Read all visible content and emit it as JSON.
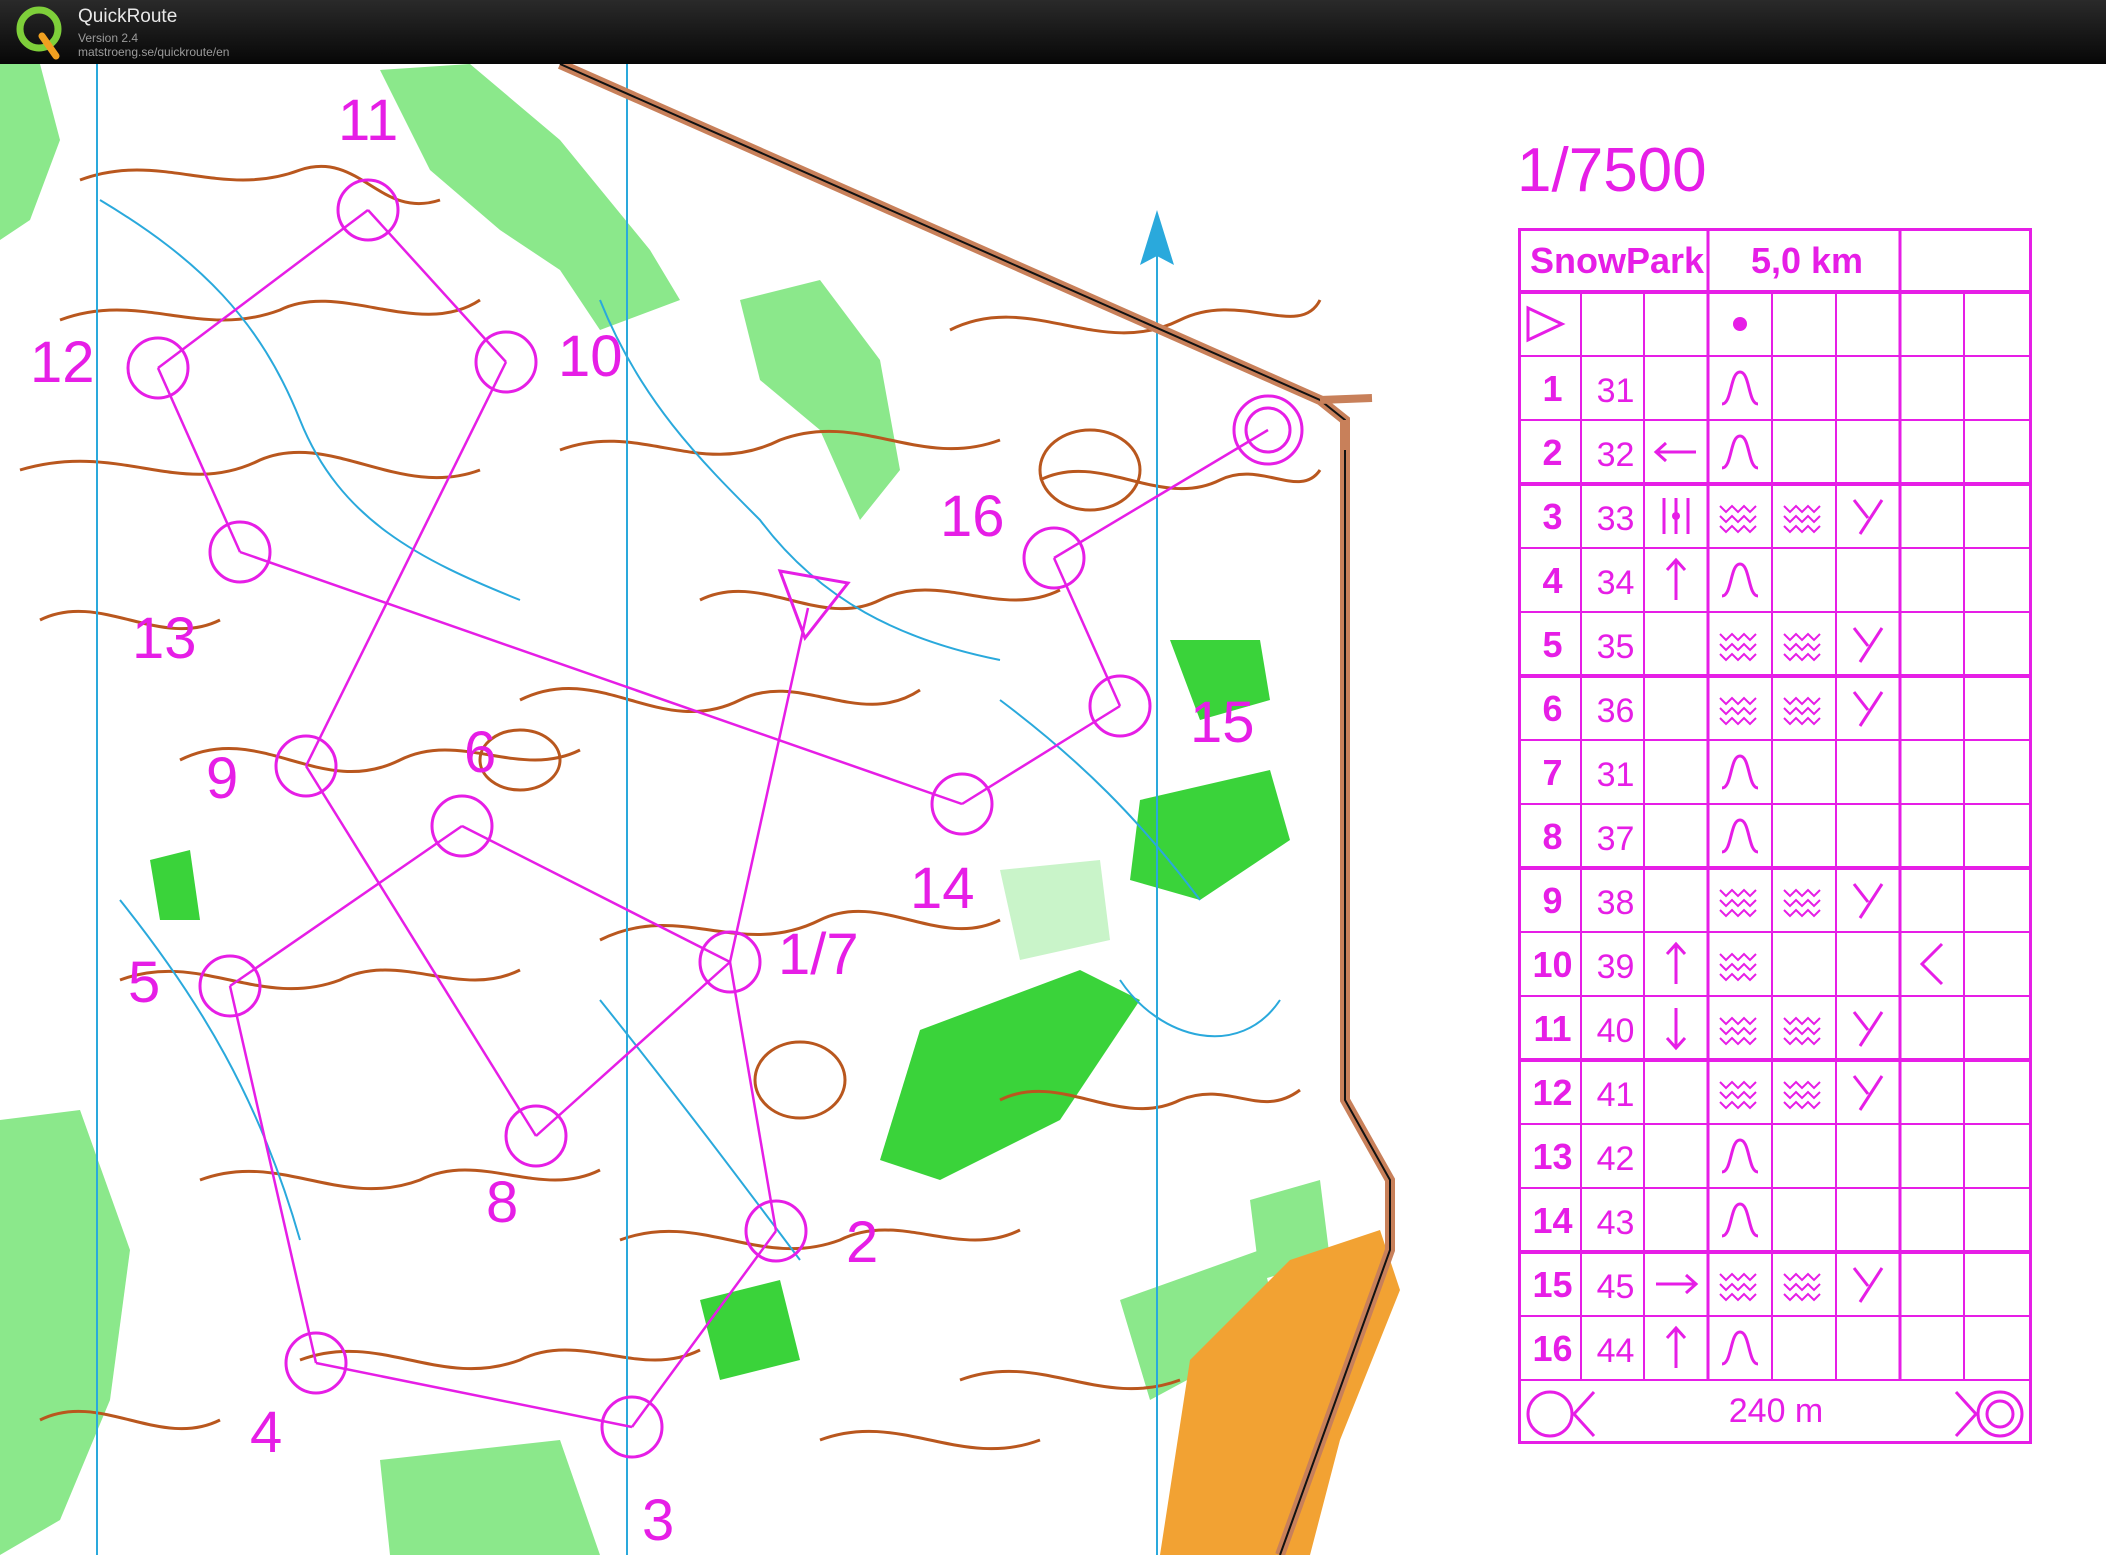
{
  "app": {
    "name": "QuickRoute",
    "version": "Version 2.4",
    "url": "matstroeng.se/quickroute/en"
  },
  "map": {
    "scale": "1/7500",
    "colors": {
      "course": "#e61ee6",
      "contour": "#b9571e",
      "water": "#2aa9dc",
      "green_light": "#8be88b",
      "green": "#3ad33a",
      "orange": "#f2a233",
      "road": "#c8805a"
    },
    "north_arrow_icon": "north-arrow-icon",
    "start_label": "",
    "control_labels": [
      "11",
      "12",
      "10",
      "16",
      "13",
      "15",
      "9",
      "6",
      "14",
      "5",
      "1/7",
      "8",
      "2",
      "4",
      "3"
    ]
  },
  "description": {
    "event": "SnowPark",
    "length": "5,0 km",
    "start_row": {
      "symbol": "start-triangle-icon",
      "column_f": "dot-icon"
    },
    "rows": [
      {
        "num": "1",
        "code": "31",
        "d": "",
        "e": "knoll-icon",
        "f": "",
        "g": "",
        "h": ""
      },
      {
        "num": "2",
        "code": "32",
        "d": "arrow-left-icon",
        "e": "knoll-icon",
        "f": "",
        "g": "",
        "h": ""
      },
      {
        "num": "3",
        "code": "33",
        "d": "between-icon",
        "e": "gully-icon",
        "f": "gully-icon",
        "g": "junction-icon",
        "h": ""
      },
      {
        "num": "4",
        "code": "34",
        "d": "arrow-up-icon",
        "e": "knoll-icon",
        "f": "",
        "g": "",
        "h": ""
      },
      {
        "num": "5",
        "code": "35",
        "d": "",
        "e": "gully-icon",
        "f": "gully-icon",
        "g": "junction-icon",
        "h": ""
      },
      {
        "num": "6",
        "code": "36",
        "d": "",
        "e": "gully-icon",
        "f": "gully-icon",
        "g": "junction-icon",
        "h": ""
      },
      {
        "num": "7",
        "code": "31",
        "d": "",
        "e": "knoll-icon",
        "f": "",
        "g": "",
        "h": ""
      },
      {
        "num": "8",
        "code": "37",
        "d": "",
        "e": "knoll-icon",
        "f": "",
        "g": "",
        "h": ""
      },
      {
        "num": "9",
        "code": "38",
        "d": "",
        "e": "gully-icon",
        "f": "gully-icon",
        "g": "junction-icon",
        "h": ""
      },
      {
        "num": "10",
        "code": "39",
        "d": "arrow-up-icon",
        "e": "gully-icon",
        "f": "",
        "g": "",
        "h": "bend-icon"
      },
      {
        "num": "11",
        "code": "40",
        "d": "arrow-down-icon",
        "e": "gully-icon",
        "f": "gully-icon",
        "g": "junction-icon",
        "h": ""
      },
      {
        "num": "12",
        "code": "41",
        "d": "",
        "e": "gully-icon",
        "f": "gully-icon",
        "g": "junction-icon",
        "h": ""
      },
      {
        "num": "13",
        "code": "42",
        "d": "",
        "e": "knoll-icon",
        "f": "",
        "g": "",
        "h": ""
      },
      {
        "num": "14",
        "code": "43",
        "d": "",
        "e": "knoll-icon",
        "f": "",
        "g": "",
        "h": ""
      },
      {
        "num": "15",
        "code": "45",
        "d": "arrow-right-icon",
        "e": "gully-icon",
        "f": "gully-icon",
        "g": "junction-icon",
        "h": ""
      },
      {
        "num": "16",
        "code": "44",
        "d": "arrow-up-icon",
        "e": "knoll-icon",
        "f": "",
        "g": "",
        "h": ""
      }
    ],
    "finish_distance": "240 m"
  }
}
